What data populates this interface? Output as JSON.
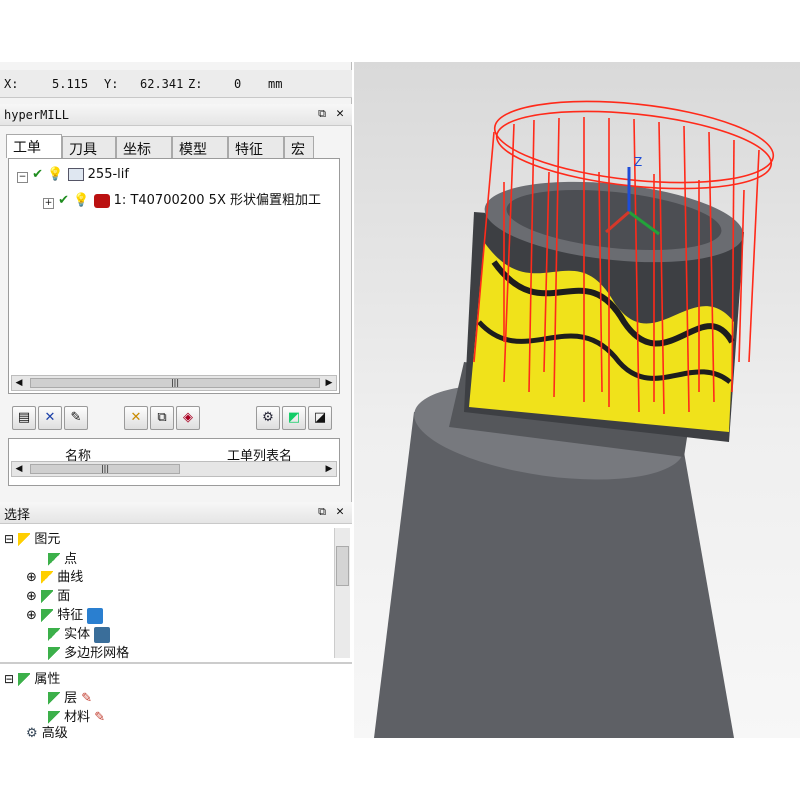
{
  "coords": {
    "x_label": "X:",
    "x": "5.115",
    "y_label": "Y:",
    "y": "62.341",
    "z_label": "Z:",
    "z": "0",
    "unit": "mm"
  },
  "panel": {
    "title": "hyperMILL"
  },
  "tabs": [
    "工单",
    "刀具",
    "坐标",
    "模型",
    "特征",
    "宏"
  ],
  "tree": {
    "root": "255-lif",
    "job": "1: T40700200 5X 形状偏置粗加工"
  },
  "list": {
    "col_name": "名称",
    "col_list": "工单列表名"
  },
  "selection": {
    "title": "选择",
    "root": "图元",
    "items": [
      "点",
      "曲线",
      "面",
      "特征",
      "实体",
      "多边形网格"
    ],
    "attr_root": "属性",
    "attr_items": [
      "层",
      "材料"
    ],
    "advanced": "高级"
  },
  "viewport": {
    "axis_z": "Z"
  },
  "colors": {
    "toolpath": "#ff2a1a",
    "machined": "#f2e600",
    "stock": "#5f6166"
  }
}
